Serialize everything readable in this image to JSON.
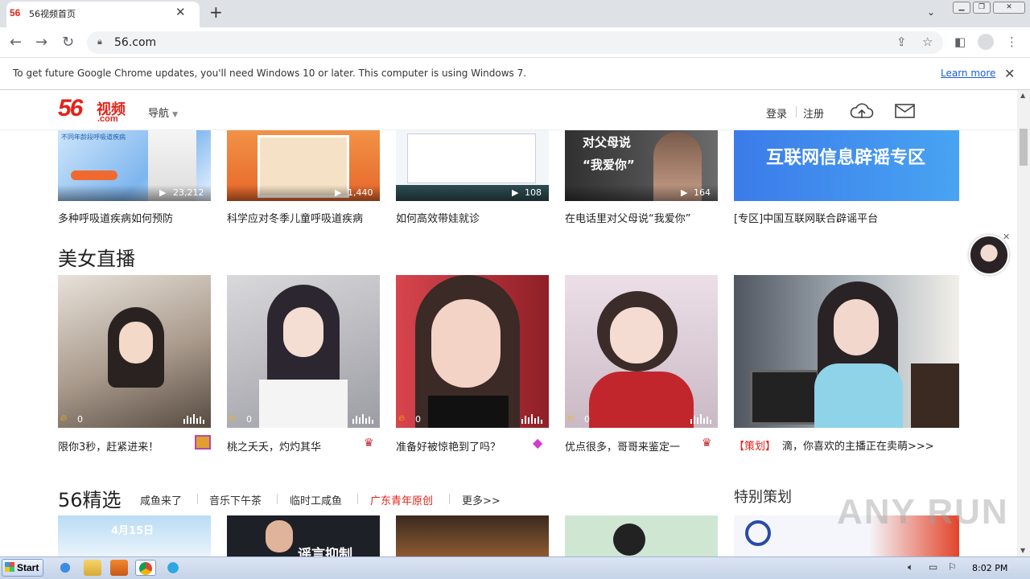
{
  "browser": {
    "tab_logo": "56",
    "tab_title": "56视频首页",
    "url": "56.com",
    "infobar_text": "To get future Google Chrome updates, you'll need Windows 10 or later. This computer is using Windows 7.",
    "infobar_link": "Learn more"
  },
  "site": {
    "logo_num": "56",
    "logo_cn": "视频",
    "logo_com": ".com",
    "nav_label": "导航",
    "login": "登录",
    "register": "注册"
  },
  "top_row": [
    {
      "caption": "多种呼吸道疾病如何预防",
      "views": "23,212"
    },
    {
      "caption": "科学应对冬季儿童呼吸道疾病",
      "views": "1,440"
    },
    {
      "caption": "如何高效带娃就诊",
      "views": "108"
    },
    {
      "caption": "在电话里对父母说“我爱你”",
      "views": "164"
    },
    {
      "caption": "[专区]中国互联网联合辟谣平台",
      "banner_text": "互联网信息辟谣专区"
    }
  ],
  "live_section": {
    "title": "美女直播",
    "items": [
      {
        "caption": "限你3秒，赶紧进来！",
        "count": "0"
      },
      {
        "caption": "桃之夭夭，灼灼其华",
        "count": "0"
      },
      {
        "caption": "准备好被惊艳到了吗？",
        "count": "0"
      },
      {
        "caption": "优点很多，哥哥来鉴定一",
        "count": "0"
      }
    ],
    "promo_tag": "【策划】",
    "promo_text": "滴，你喜欢的主播正在卖萌>>>"
  },
  "featured": {
    "title": "56精选",
    "tabs": [
      "咸鱼来了",
      "音乐下午茶",
      "临时工咸鱼",
      "广东青年原创",
      "更多>>"
    ],
    "side_title": "特别策划",
    "thumb_texts": [
      "4月15日",
      "谣言抑制"
    ]
  },
  "taskbar": {
    "start": "Start",
    "clock": "8:02 PM"
  },
  "watermark": "ANY RUN",
  "colors": {
    "brand": "#e2231a",
    "promo": "#e2231a"
  }
}
